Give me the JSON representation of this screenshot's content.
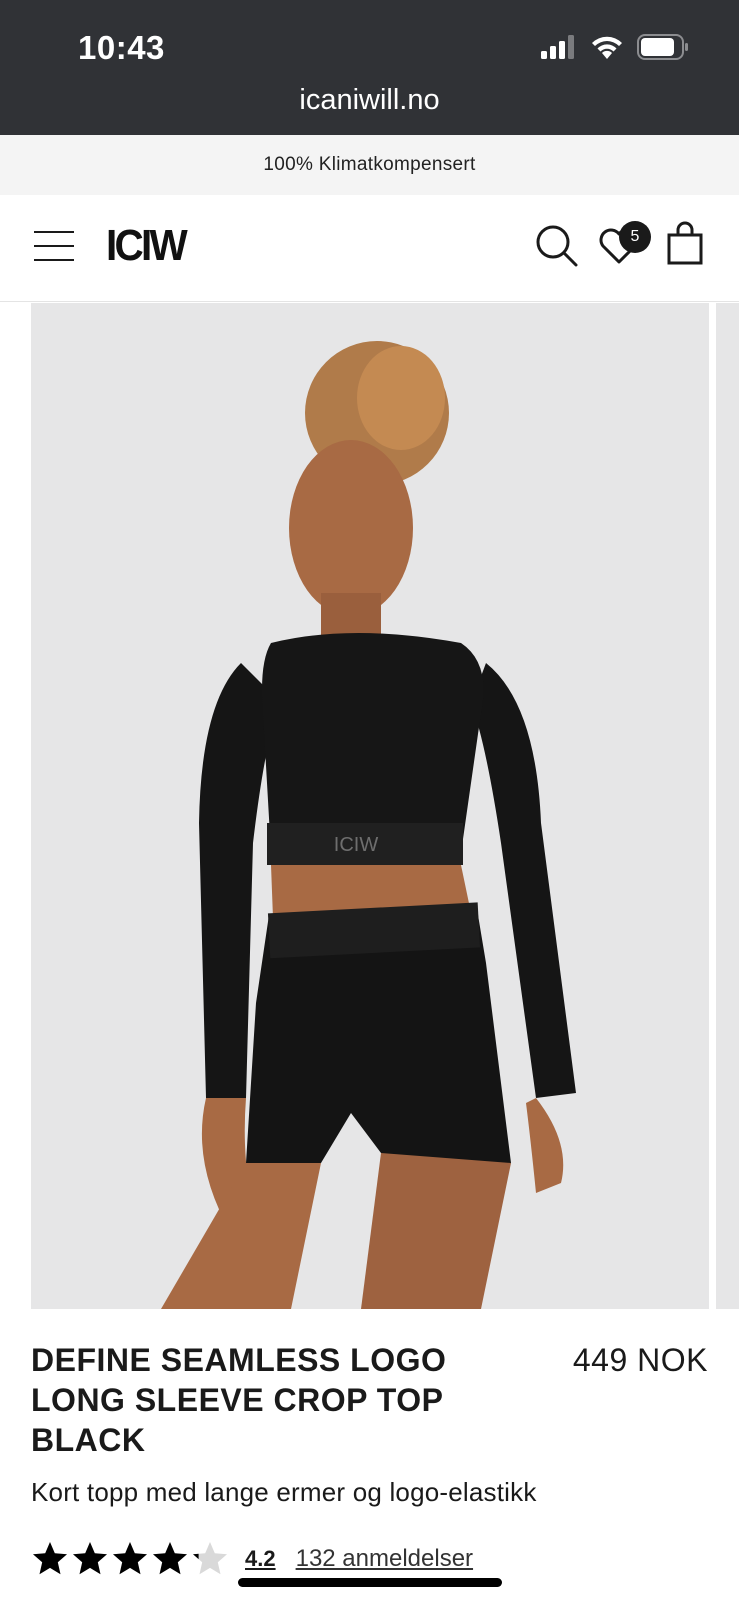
{
  "status_bar": {
    "time": "10:43"
  },
  "browser": {
    "url": "icaniwill.no"
  },
  "promo": {
    "text": "100% Klimatkompensert"
  },
  "header": {
    "logo": "ICIW",
    "wishlist_count": "5"
  },
  "product": {
    "title": "DEFINE SEAMLESS LOGO LONG SLEEVE CROP TOP BLACK",
    "price": "449 NOK",
    "subtitle": "Kort topp med lange ermer og logo-elastikk",
    "rating": "4.2",
    "rating_fraction": 0.84,
    "reviews": "132 anmeldelser",
    "image_band_text": "ICIW"
  },
  "colors": {
    "browser_bg": "#303236",
    "promo_bg": "#f4f4f4",
    "image_bg": "#e6e6e7",
    "text": "#1a1a1a"
  },
  "icons": [
    "signal-icon",
    "wifi-icon",
    "battery-icon",
    "menu-icon",
    "search-icon",
    "heart-icon",
    "bag-icon",
    "star-icon"
  ]
}
